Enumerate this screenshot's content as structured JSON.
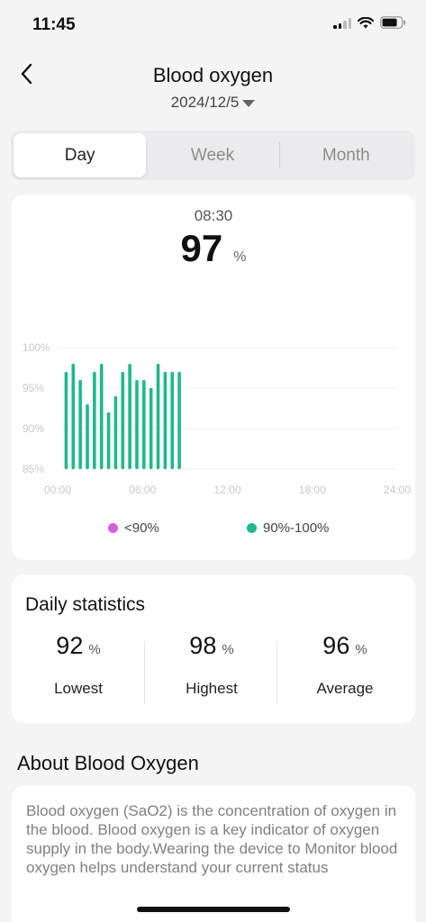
{
  "status_bar": {
    "time": "11:45"
  },
  "header": {
    "title": "Blood oxygen",
    "date": "2024/12/5"
  },
  "tabs": [
    {
      "label": "Day",
      "active": true
    },
    {
      "label": "Week",
      "active": false
    },
    {
      "label": "Month",
      "active": false
    }
  ],
  "selected": {
    "time": "08:30",
    "value": "97",
    "unit": "%"
  },
  "colors": {
    "normal": "#1fb88c",
    "low": "#d55fe0",
    "accent": "#1fb88c"
  },
  "chart_data": {
    "type": "bar",
    "ylim": [
      85,
      100
    ],
    "y_ticks": [
      100,
      95,
      90,
      85
    ],
    "y_tick_labels": [
      "100%",
      "95%",
      "90%",
      "85%"
    ],
    "xlim": [
      0,
      24
    ],
    "x_ticks": [
      0,
      6,
      12,
      18,
      24
    ],
    "x_tick_labels": [
      "00:00",
      "06:00",
      "12:00",
      "18:00",
      "24:00"
    ],
    "x_hours": [
      0.6,
      1.1,
      1.6,
      2.1,
      2.6,
      3.1,
      3.6,
      4.1,
      4.6,
      5.1,
      5.6,
      6.1,
      6.6,
      7.1,
      7.6,
      8.1,
      8.6
    ],
    "values": [
      97,
      98,
      96,
      93,
      97,
      98,
      92,
      94,
      97,
      98,
      96,
      96,
      95,
      98,
      97,
      97,
      97
    ],
    "legend": [
      {
        "label": "<90%",
        "color": "#d55fe0"
      },
      {
        "label": "90%-100%",
        "color": "#1fb88c"
      }
    ]
  },
  "stats": {
    "title": "Daily statistics",
    "unit": "%",
    "lowest": {
      "value": "92",
      "label": "Lowest"
    },
    "highest": {
      "value": "98",
      "label": "Highest"
    },
    "average": {
      "value": "96",
      "label": "Average"
    }
  },
  "about": {
    "title": "About Blood Oxygen",
    "text": "Blood oxygen (SaO2) is the concentration of oxygen in the blood. Blood oxygen is a key indicator of oxygen supply in the body.Wearing the device to Monitor blood oxygen helps understand your current status"
  }
}
